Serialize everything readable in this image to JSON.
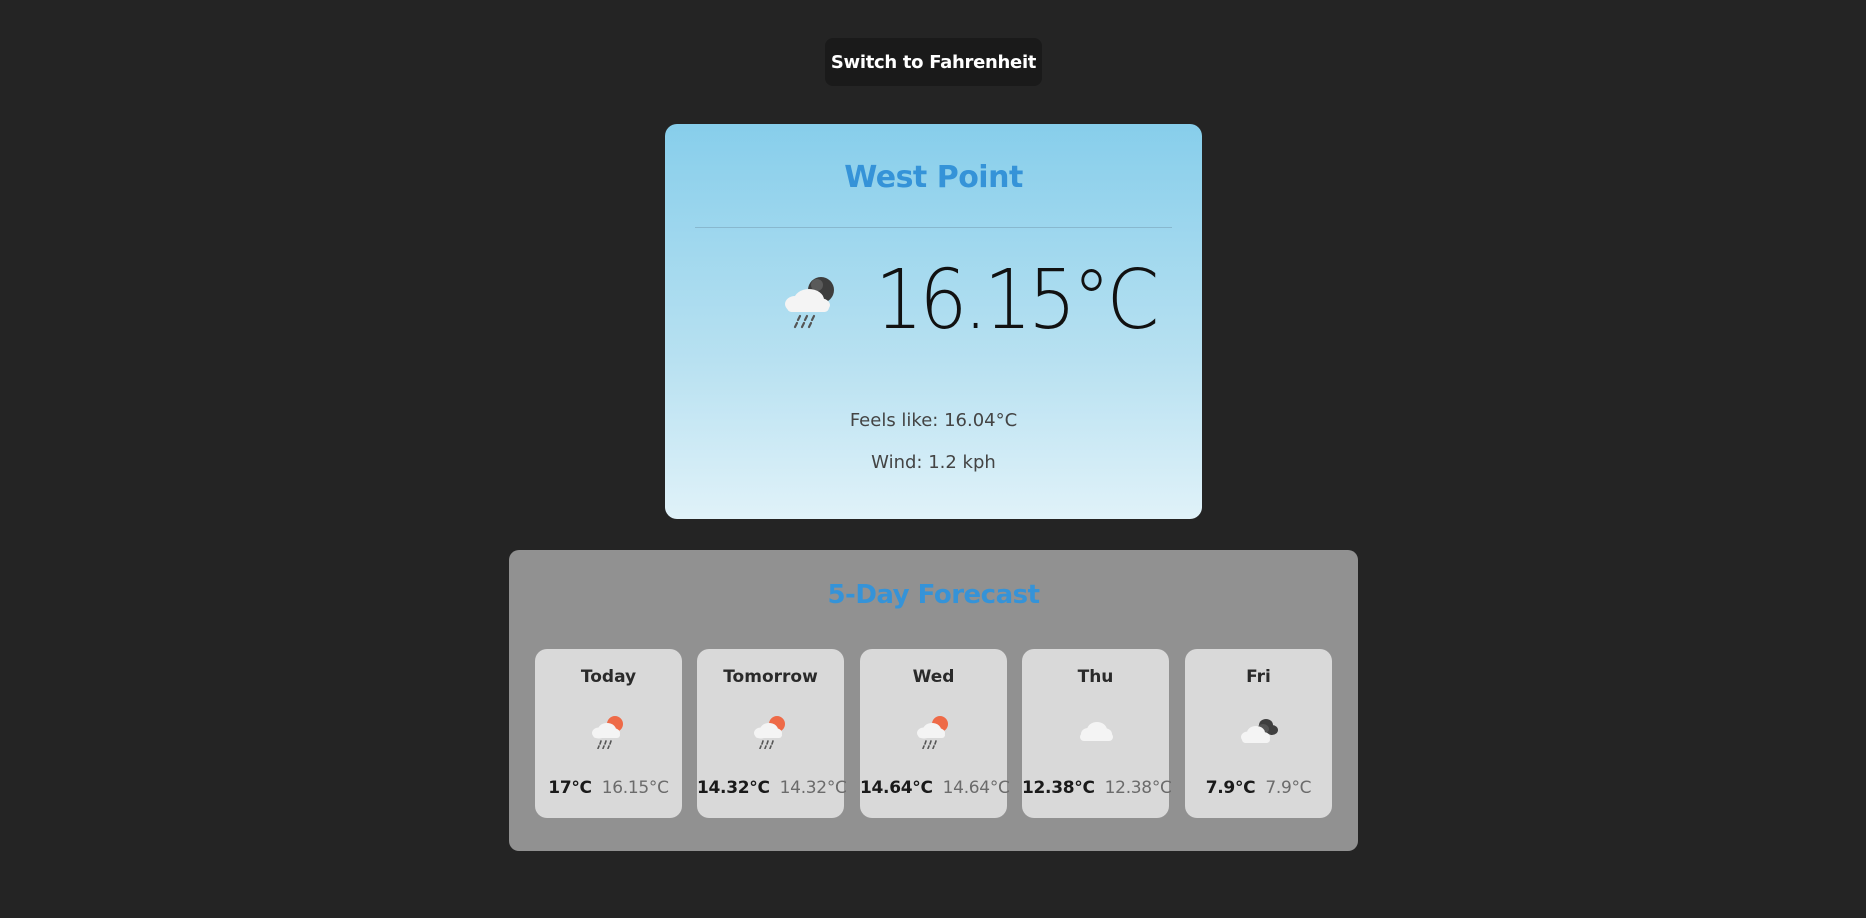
{
  "toggle": {
    "label": "Switch to Fahrenheit"
  },
  "current": {
    "city": "West Point",
    "temperature": "16.15°C",
    "feels_like": "Feels like: 16.04°C",
    "wind": "Wind: 1.2 kph",
    "icon": "rain-night-cloud-icon"
  },
  "forecast": {
    "title": "5-Day Forecast",
    "days": [
      {
        "label": "Today",
        "max": "17°C",
        "min": "16.15°C",
        "icon": "rain-sun-cloud-icon"
      },
      {
        "label": "Tomorrow",
        "max": "14.32°C",
        "min": "14.32°C",
        "icon": "rain-sun-cloud-icon"
      },
      {
        "label": "Wed",
        "max": "14.64°C",
        "min": "14.64°C",
        "icon": "rain-sun-cloud-icon"
      },
      {
        "label": "Thu",
        "max": "12.38°C",
        "min": "12.38°C",
        "icon": "cloud-icon"
      },
      {
        "label": "Fri",
        "max": "7.9°C",
        "min": "7.9°C",
        "icon": "dark-clouds-icon"
      }
    ]
  },
  "colors": {
    "background": "#242424",
    "accent": "#3593d8",
    "card_gradient_top": "#87ceeb",
    "card_gradient_bottom": "#e0f2f9",
    "forecast_panel": "#919191",
    "day_card": "#d9d9d9"
  }
}
